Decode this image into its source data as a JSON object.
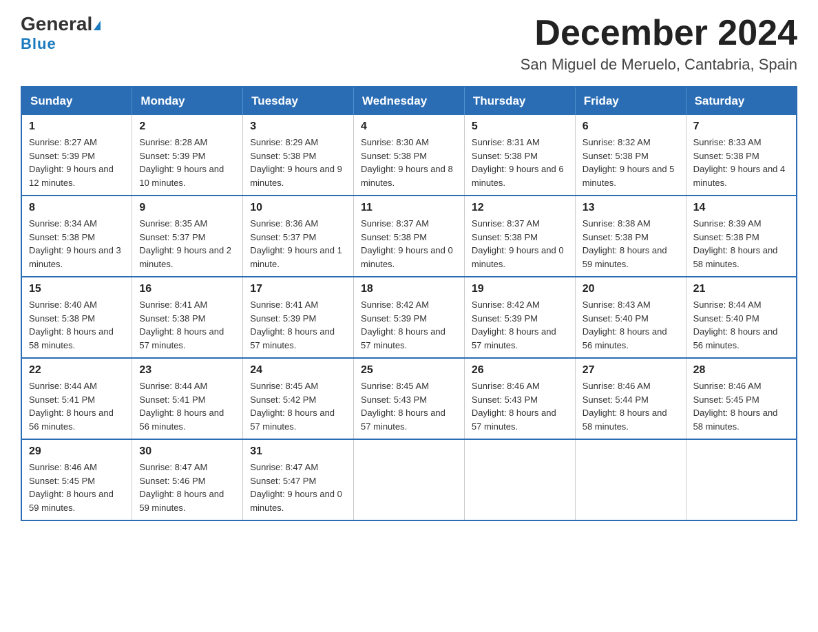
{
  "header": {
    "logo_general": "General",
    "logo_blue": "Blue",
    "month_title": "December 2024",
    "location": "San Miguel de Meruelo, Cantabria, Spain"
  },
  "days_of_week": [
    "Sunday",
    "Monday",
    "Tuesday",
    "Wednesday",
    "Thursday",
    "Friday",
    "Saturday"
  ],
  "weeks": [
    [
      {
        "day": "1",
        "sunrise": "8:27 AM",
        "sunset": "5:39 PM",
        "daylight": "9 hours and 12 minutes."
      },
      {
        "day": "2",
        "sunrise": "8:28 AM",
        "sunset": "5:39 PM",
        "daylight": "9 hours and 10 minutes."
      },
      {
        "day": "3",
        "sunrise": "8:29 AM",
        "sunset": "5:38 PM",
        "daylight": "9 hours and 9 minutes."
      },
      {
        "day": "4",
        "sunrise": "8:30 AM",
        "sunset": "5:38 PM",
        "daylight": "9 hours and 8 minutes."
      },
      {
        "day": "5",
        "sunrise": "8:31 AM",
        "sunset": "5:38 PM",
        "daylight": "9 hours and 6 minutes."
      },
      {
        "day": "6",
        "sunrise": "8:32 AM",
        "sunset": "5:38 PM",
        "daylight": "9 hours and 5 minutes."
      },
      {
        "day": "7",
        "sunrise": "8:33 AM",
        "sunset": "5:38 PM",
        "daylight": "9 hours and 4 minutes."
      }
    ],
    [
      {
        "day": "8",
        "sunrise": "8:34 AM",
        "sunset": "5:38 PM",
        "daylight": "9 hours and 3 minutes."
      },
      {
        "day": "9",
        "sunrise": "8:35 AM",
        "sunset": "5:37 PM",
        "daylight": "9 hours and 2 minutes."
      },
      {
        "day": "10",
        "sunrise": "8:36 AM",
        "sunset": "5:37 PM",
        "daylight": "9 hours and 1 minute."
      },
      {
        "day": "11",
        "sunrise": "8:37 AM",
        "sunset": "5:38 PM",
        "daylight": "9 hours and 0 minutes."
      },
      {
        "day": "12",
        "sunrise": "8:37 AM",
        "sunset": "5:38 PM",
        "daylight": "9 hours and 0 minutes."
      },
      {
        "day": "13",
        "sunrise": "8:38 AM",
        "sunset": "5:38 PM",
        "daylight": "8 hours and 59 minutes."
      },
      {
        "day": "14",
        "sunrise": "8:39 AM",
        "sunset": "5:38 PM",
        "daylight": "8 hours and 58 minutes."
      }
    ],
    [
      {
        "day": "15",
        "sunrise": "8:40 AM",
        "sunset": "5:38 PM",
        "daylight": "8 hours and 58 minutes."
      },
      {
        "day": "16",
        "sunrise": "8:41 AM",
        "sunset": "5:38 PM",
        "daylight": "8 hours and 57 minutes."
      },
      {
        "day": "17",
        "sunrise": "8:41 AM",
        "sunset": "5:39 PM",
        "daylight": "8 hours and 57 minutes."
      },
      {
        "day": "18",
        "sunrise": "8:42 AM",
        "sunset": "5:39 PM",
        "daylight": "8 hours and 57 minutes."
      },
      {
        "day": "19",
        "sunrise": "8:42 AM",
        "sunset": "5:39 PM",
        "daylight": "8 hours and 57 minutes."
      },
      {
        "day": "20",
        "sunrise": "8:43 AM",
        "sunset": "5:40 PM",
        "daylight": "8 hours and 56 minutes."
      },
      {
        "day": "21",
        "sunrise": "8:44 AM",
        "sunset": "5:40 PM",
        "daylight": "8 hours and 56 minutes."
      }
    ],
    [
      {
        "day": "22",
        "sunrise": "8:44 AM",
        "sunset": "5:41 PM",
        "daylight": "8 hours and 56 minutes."
      },
      {
        "day": "23",
        "sunrise": "8:44 AM",
        "sunset": "5:41 PM",
        "daylight": "8 hours and 56 minutes."
      },
      {
        "day": "24",
        "sunrise": "8:45 AM",
        "sunset": "5:42 PM",
        "daylight": "8 hours and 57 minutes."
      },
      {
        "day": "25",
        "sunrise": "8:45 AM",
        "sunset": "5:43 PM",
        "daylight": "8 hours and 57 minutes."
      },
      {
        "day": "26",
        "sunrise": "8:46 AM",
        "sunset": "5:43 PM",
        "daylight": "8 hours and 57 minutes."
      },
      {
        "day": "27",
        "sunrise": "8:46 AM",
        "sunset": "5:44 PM",
        "daylight": "8 hours and 58 minutes."
      },
      {
        "day": "28",
        "sunrise": "8:46 AM",
        "sunset": "5:45 PM",
        "daylight": "8 hours and 58 minutes."
      }
    ],
    [
      {
        "day": "29",
        "sunrise": "8:46 AM",
        "sunset": "5:45 PM",
        "daylight": "8 hours and 59 minutes."
      },
      {
        "day": "30",
        "sunrise": "8:47 AM",
        "sunset": "5:46 PM",
        "daylight": "8 hours and 59 minutes."
      },
      {
        "day": "31",
        "sunrise": "8:47 AM",
        "sunset": "5:47 PM",
        "daylight": "9 hours and 0 minutes."
      },
      null,
      null,
      null,
      null
    ]
  ],
  "labels": {
    "sunrise": "Sunrise:",
    "sunset": "Sunset:",
    "daylight": "Daylight:"
  }
}
